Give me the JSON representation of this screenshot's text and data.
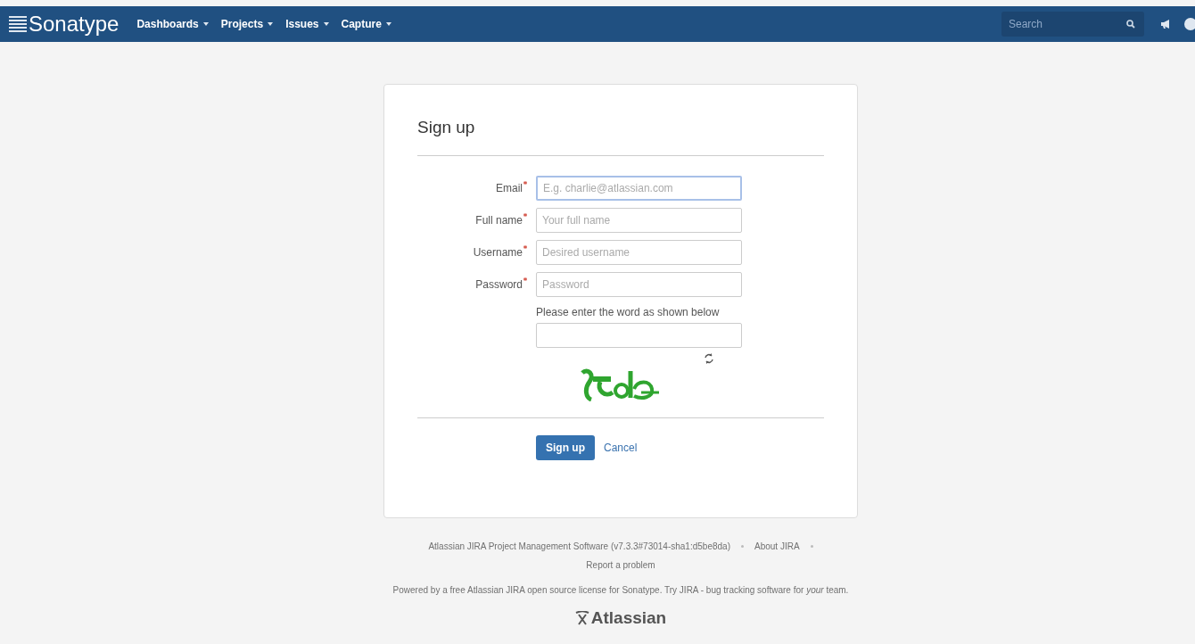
{
  "nav": {
    "logo": "Sonatype",
    "menus": [
      "Dashboards",
      "Projects",
      "Issues",
      "Capture"
    ],
    "search": {
      "placeholder": "Search"
    }
  },
  "form": {
    "title": "Sign up",
    "fields": [
      {
        "label": "Email",
        "required": true,
        "placeholder": "E.g. charlie@atlassian.com",
        "focused": true
      },
      {
        "label": "Full name",
        "required": true,
        "placeholder": "Your full name",
        "focused": false
      },
      {
        "label": "Username",
        "required": true,
        "placeholder": "Desired username",
        "focused": false
      },
      {
        "label": "Password",
        "required": true,
        "placeholder": "Password",
        "focused": false
      }
    ],
    "captcha": {
      "prompt": "Please enter the word as shown below"
    },
    "submit": "Sign up",
    "cancel": "Cancel"
  },
  "footer": {
    "version": "Atlassian JIRA Project Management Software (v7.3.3#73014-sha1:d5be8da)",
    "about": "About JIRA",
    "report": "Report a problem",
    "powered": "Powered by a free Atlassian JIRA open source license for Sonatype. Try JIRA - bug tracking software for *your* team.",
    "brand": "Atlassian"
  }
}
